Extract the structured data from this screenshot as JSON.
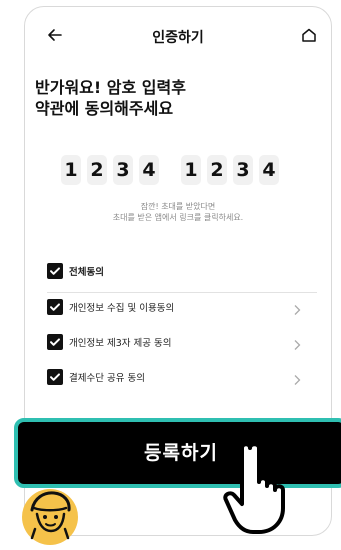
{
  "header": {
    "title": "인증하기"
  },
  "heading": {
    "line1": "반가워요! 암호 입력후",
    "line2": "약관에 동의해주세요"
  },
  "code": {
    "group1": [
      "1",
      "2",
      "3",
      "4"
    ],
    "group2": [
      "1",
      "2",
      "3",
      "4"
    ]
  },
  "hint": {
    "line1": "잠깐! 초대를 받았다면",
    "line2": "초대를 받은 앱에서 링크를 클릭하세요."
  },
  "agreements": {
    "all_label": "전체동의",
    "items": [
      {
        "label": "개인정보 수집 및 이용동의"
      },
      {
        "label": "개인정보 제3자 제공 동의"
      },
      {
        "label": "결제수단 공유 동의"
      }
    ]
  },
  "button": {
    "register_label": "등록하기"
  },
  "colors": {
    "button_border": "#2fbfb1",
    "button_bg": "#000000",
    "checkbox": "#111111"
  },
  "icons": [
    "back-arrow-icon",
    "home-icon",
    "checkbox-checked-icon",
    "chevron-right-icon",
    "pointing-hand-icon",
    "avatar-icon"
  ]
}
